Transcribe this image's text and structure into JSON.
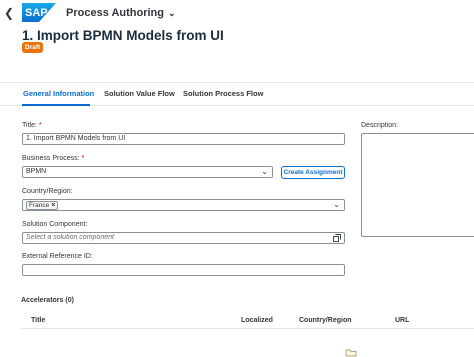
{
  "shell": {
    "logo_text": "SAP",
    "app_title": "Process Authoring",
    "colors": {
      "logo_top": "#19a9e8",
      "logo_bottom": "#0a6ed1"
    }
  },
  "header": {
    "title": "1. Import BPMN Models from UI",
    "status_badge": "Draft",
    "badge_color": "#e9730c"
  },
  "tabs": [
    {
      "label": "General Information",
      "active": true
    },
    {
      "label": "Solution Value Flow",
      "active": false
    },
    {
      "label": "Solution Process Flow",
      "active": false
    }
  ],
  "form": {
    "title": {
      "label": "Title:",
      "required_mark": "*",
      "value": "1. Import BPMN Models from UI"
    },
    "business_process": {
      "label": "Business Process:",
      "required_mark": "*",
      "value": "BPMN"
    },
    "create_assignment_label": "Create Assignment",
    "country_region": {
      "label": "Country/Region:",
      "token": "France"
    },
    "solution_component": {
      "label": "Solution Component:",
      "placeholder": "Select a solution component"
    },
    "external_reference": {
      "label": "External Reference ID:",
      "value": ""
    },
    "description": {
      "label": "Description:"
    }
  },
  "accelerators": {
    "title": "Accelerators (0)",
    "columns": [
      "Title",
      "Localized",
      "Country/Region",
      "URL"
    ]
  }
}
